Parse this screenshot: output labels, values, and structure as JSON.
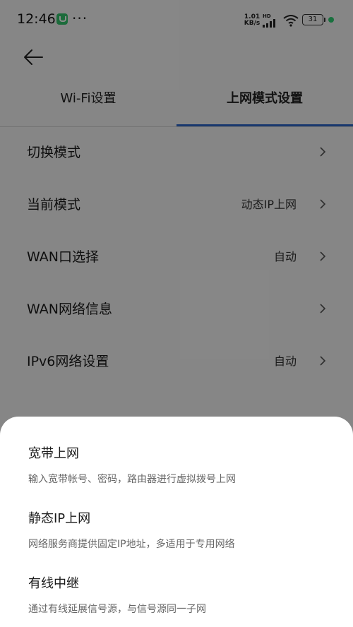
{
  "status_bar": {
    "time": "12:46",
    "app_icon": "shield-icon",
    "more": "···",
    "speed_value": "1.01",
    "speed_unit": "KB/s",
    "hd": "HD",
    "battery": "31"
  },
  "header": {
    "back_icon": "arrow-left-icon"
  },
  "tabs": [
    {
      "label": "Wi-Fi设置",
      "active": false
    },
    {
      "label": "上网模式设置",
      "active": true
    }
  ],
  "settings": [
    {
      "label": "切换模式",
      "value": ""
    },
    {
      "label": "当前模式",
      "value": "动态IP上网"
    },
    {
      "label": "WAN口选择",
      "value": "自动"
    },
    {
      "label": "WAN网络信息",
      "value": ""
    },
    {
      "label": "IPv6网络设置",
      "value": "自动"
    }
  ],
  "sheet_options": [
    {
      "title": "宽带上网",
      "desc": "输入宽带帐号、密码，路由器进行虚拟拨号上网"
    },
    {
      "title": "静态IP上网",
      "desc": "网络服务商提供固定IP地址，多适用于专用网络"
    },
    {
      "title": "有线中继",
      "desc": "通过有线延展信号源，与信号源同一子网"
    }
  ],
  "colors": {
    "accent": "#2f66c8",
    "charge": "#2ecc71",
    "app": "#34c46c"
  }
}
